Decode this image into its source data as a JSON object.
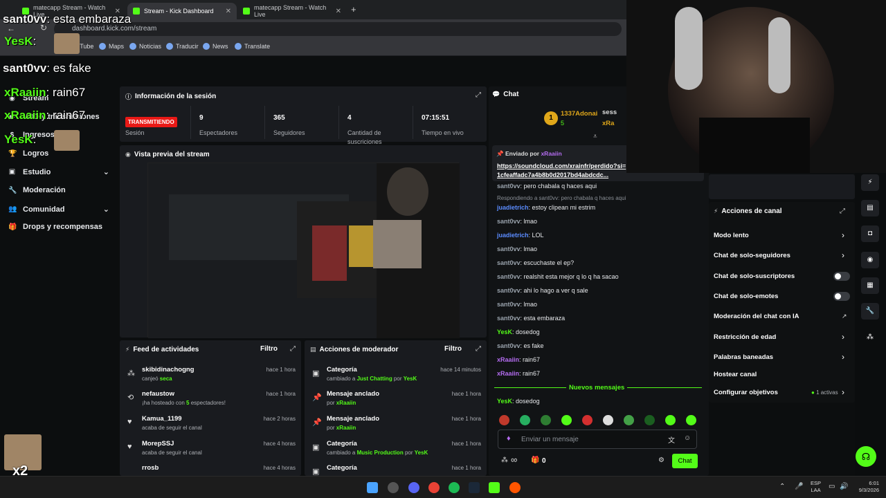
{
  "browser": {
    "tabs": [
      {
        "label": "matecapp Stream - Watch Live"
      },
      {
        "label": "Stream - Kick Dashboard"
      },
      {
        "label": "matecapp Stream - Watch Live"
      }
    ],
    "new_tab": "+",
    "url": "dashboard.kick.com/stream",
    "bookmarks": [
      "YouTube",
      "Maps",
      "Noticias",
      "Traducir",
      "News",
      "Translate"
    ]
  },
  "sidebar": {
    "items": [
      {
        "label": "Stream"
      },
      {
        "label": "VOD y transmisiones"
      },
      {
        "label": "Ingresos"
      },
      {
        "label": "Logros"
      },
      {
        "label": "Estudio"
      },
      {
        "label": "Moderación"
      },
      {
        "label": "Comunidad"
      },
      {
        "label": "Drops y recompensas"
      }
    ]
  },
  "session": {
    "title": "Información de la sesión",
    "live_badge": "TRANSMITIENDO",
    "session_label": "Sesión",
    "stats": [
      {
        "value": "9",
        "label": "Espectadores"
      },
      {
        "value": "365",
        "label": "Seguidores"
      },
      {
        "value": "4",
        "label": "Cantidad de suscriciones"
      },
      {
        "value": "07:15:51",
        "label": "Tiempo en vivo"
      }
    ]
  },
  "preview": {
    "title": "Vista previa del stream"
  },
  "feed": {
    "title": "Feed de actividades",
    "filter": "Filtro",
    "items": [
      {
        "name": "skibidinachogng",
        "pre": "canjeó ",
        "hl": "seca",
        "post": "",
        "time": "hace 1 hora"
      },
      {
        "name": "nefaustow",
        "pre": "¡ha hosteado con ",
        "hl": "5",
        "post": " espectadores!",
        "time": "hace 1 hora"
      },
      {
        "name": "Kamua_1199",
        "pre": "acaba de seguir el canal",
        "hl": "",
        "post": "",
        "time": "hace 2 horas"
      },
      {
        "name": "MorepSSJ",
        "pre": "acaba de seguir el canal",
        "hl": "",
        "post": "",
        "time": "hace 4 horas"
      },
      {
        "name": "rrosb",
        "pre": "",
        "hl": "",
        "post": "",
        "time": "hace 4 horas"
      }
    ]
  },
  "mod": {
    "title": "Acciones de moderador",
    "filter": "Filtro",
    "items": [
      {
        "name": "Categoría",
        "pre": "cambiado a ",
        "hl": "Just Chatting",
        "mid": " por ",
        "hl2": "YesK",
        "time": "hace 14 minutos"
      },
      {
        "name": "Mensaje anclado",
        "pre": "por ",
        "hl": "xRaaiin",
        "mid": "",
        "hl2": "",
        "time": "hace 1 hora"
      },
      {
        "name": "Mensaje anclado",
        "pre": "por ",
        "hl": "xRaaiin",
        "mid": "",
        "hl2": "",
        "time": "hace 1 hora"
      },
      {
        "name": "Categoría",
        "pre": "cambiado a ",
        "hl": "Music Production",
        "mid": " por ",
        "hl2": "YesK",
        "time": "hace 1 hora"
      },
      {
        "name": "Categoría",
        "pre": "",
        "hl": "",
        "mid": "",
        "hl2": "",
        "time": "hace 1 hora"
      }
    ]
  },
  "chat": {
    "title": "Chat",
    "top_gifter": {
      "name": "1337Adonai",
      "count": "5"
    },
    "top_gifter2": {
      "name": "sess",
      "name2": "xRa"
    },
    "pinned": {
      "by_label": "Enviado por",
      "by": "xRaaiin",
      "link": "https://soundcloud.com/xrainfr/perdido?si=1cfeaffadc7a4b8b0d2017bd4abdcdc..."
    },
    "reply_hint": "Respondiendo a sant0vv: pero chabala q haces aqui",
    "messages": [
      {
        "user": "sant0vv",
        "color": "gray",
        "text": "pero chabala q haces aqui"
      },
      {
        "user": "juadietrich",
        "color": "blue",
        "text": "estoy clipean mi estrim"
      },
      {
        "user": "sant0vv",
        "color": "gray",
        "text": "lmao"
      },
      {
        "user": "juadietrich",
        "color": "blue",
        "text": "LOL"
      },
      {
        "user": "sant0vv",
        "color": "gray",
        "text": "lmao"
      },
      {
        "user": "sant0vv",
        "color": "gray",
        "text": "escuchaste el ep?"
      },
      {
        "user": "sant0vv",
        "color": "gray",
        "text": "realshit esta mejor q lo q ha sacao"
      },
      {
        "user": "sant0vv",
        "color": "gray",
        "text": "ahi lo hago a ver q sale"
      },
      {
        "user": "sant0vv",
        "color": "gray",
        "text": "lmao"
      },
      {
        "user": "sant0vv",
        "color": "gray",
        "text": "esta embaraza"
      },
      {
        "user": "YesK",
        "color": "green",
        "text": "dosedog"
      },
      {
        "user": "sant0vv",
        "color": "gray",
        "text": "es fake"
      },
      {
        "user": "xRaaiin",
        "color": "purple",
        "text": "rain67"
      },
      {
        "user": "xRaaiin",
        "color": "purple",
        "text": "rain67"
      }
    ],
    "new_messages": "Nuevos mensajes",
    "after": {
      "user": "YesK",
      "text": "dosedog"
    },
    "input_placeholder": "Enviar un mensaje",
    "send": "Chat",
    "points": "0",
    "infinity": "∞"
  },
  "channel_actions": {
    "title": "Acciones de canal",
    "items": [
      {
        "label": "Modo lento"
      },
      {
        "label": "Chat de solo-seguidores"
      },
      {
        "label": "Chat de solo-suscriptores"
      },
      {
        "label": "Chat de solo-emotes"
      },
      {
        "label": "Moderación del chat con IA"
      },
      {
        "label": "Restricción de edad"
      },
      {
        "label": "Palabras baneadas"
      },
      {
        "label": "Hostear canal"
      },
      {
        "label": "Configurar objetivos"
      }
    ],
    "goals_badge": "1 activas"
  },
  "overlay": {
    "lines": [
      {
        "user": "sant0vv",
        "text": "esta embaraza"
      },
      {
        "user": "YesK",
        "text": ""
      },
      {
        "user": "sant0vv",
        "text": "es fake"
      },
      {
        "user": "xRaaiin",
        "text": "rain67"
      },
      {
        "user": "xRaaiin",
        "text": "rain67"
      },
      {
        "user": "YesK",
        "text": ""
      }
    ],
    "multiplier": "x2"
  },
  "taskbar": {
    "lang": "ESP",
    "lang2": "LAA",
    "time": "6:01",
    "date": "9/3/2026"
  }
}
